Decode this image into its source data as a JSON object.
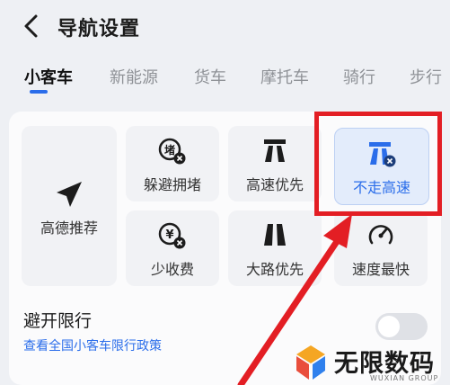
{
  "header": {
    "title": "导航设置"
  },
  "tabs": [
    {
      "label": "小客车",
      "active": true
    },
    {
      "label": "新能源"
    },
    {
      "label": "货车"
    },
    {
      "label": "摩托车"
    },
    {
      "label": "骑行"
    },
    {
      "label": "步行"
    }
  ],
  "route_options": [
    {
      "label": "高德推荐",
      "icon": "send-arrow-icon"
    },
    {
      "label": "躲避拥堵",
      "icon": "congestion-avoid-icon"
    },
    {
      "label": "高速优先",
      "icon": "highway-icon"
    },
    {
      "label": "不走高速",
      "icon": "no-highway-icon",
      "selected": true
    },
    {
      "label": "少收费",
      "icon": "yuan-no-fee-icon"
    },
    {
      "label": "大路优先",
      "icon": "main-road-icon"
    },
    {
      "label": "速度最快",
      "icon": "speedometer-icon"
    }
  ],
  "restriction": {
    "title": "避开限行",
    "link": "查看全国小客车限行政策",
    "enabled": false
  },
  "watermark": {
    "text": "无限数码",
    "sub": "WUXIAN GROUP"
  },
  "colors": {
    "accent": "#2a6dea",
    "highlight": "#e31e24",
    "background": "#eef0f4"
  }
}
